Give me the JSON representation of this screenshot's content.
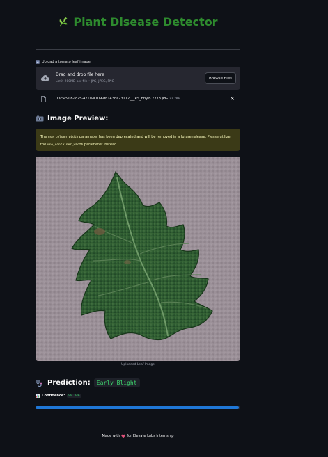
{
  "header": {
    "title": "Plant Disease Detector",
    "icon": "herb-icon",
    "title_color": "#2e8b2e"
  },
  "uploader": {
    "label": "Upload a tomato leaf image",
    "label_icon": "image-icon",
    "drop_title": "Drag and drop file here",
    "drop_subtitle": "Limit 200MB per file • JPG, JPEG, PNG",
    "browse_label": "Browse files",
    "file": {
      "name": "00c5c908-fc25-4710-a109-db143da23112___RS_Erly.B 7778.JPG",
      "size": "22.2KB",
      "close_symbol": "×"
    }
  },
  "preview": {
    "heading": "Image Preview:",
    "heading_icon": "camera-icon",
    "warning": {
      "part1": "The ",
      "code1": "use_column_width",
      "part2": " parameter has been deprecated and will be removed in a future release. Please utilize the ",
      "code2": "use_container_width",
      "part3": " parameter instead."
    },
    "caption": "Uploaded Leaf Image"
  },
  "prediction": {
    "heading": "Prediction:",
    "heading_icon": "stethoscope-icon",
    "value": "Early Blight",
    "confidence_label": "Confidence:",
    "confidence_icon": "bar-chart-icon",
    "confidence_value": "99.34%",
    "confidence_fraction": 0.9934,
    "bar_color": "#1f77d6"
  },
  "footer": {
    "text_before": "Made with",
    "heart_icon": "heart-icon",
    "text_after": "for Elevate Labs Internship"
  },
  "colors": {
    "background": "#0e1117",
    "panel": "#262730",
    "accent_green": "#3dd56d",
    "warning_bg": "#3b3a17"
  }
}
